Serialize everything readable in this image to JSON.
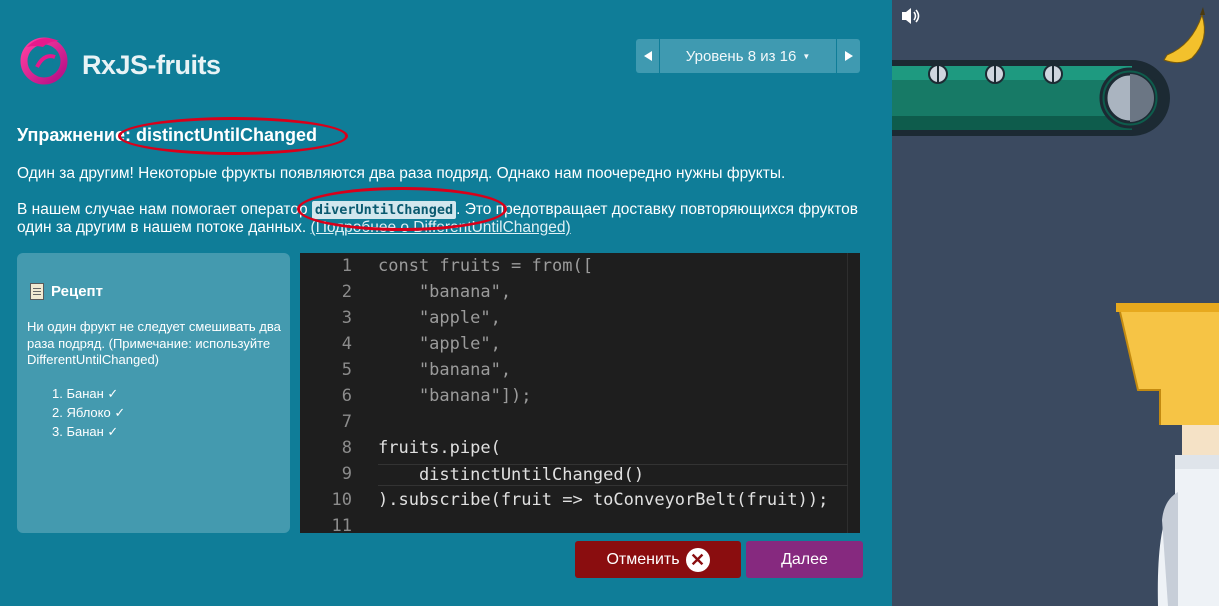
{
  "app": {
    "title": "RxJS-fruits"
  },
  "level_nav": {
    "label": "Уровень 8 из 16",
    "prev_icon": "triangle-left-icon",
    "next_icon": "triangle-right-icon"
  },
  "exercise": {
    "title": "Упражнение: distinctUntilChanged",
    "para1": "Один за другим! Некоторые фрукты появляются два раза подряд. Однако нам поочередно нужны фрукты.",
    "para2_before": "В нашем случае нам помогает оператор ",
    "para2_code": "diverUntilChanged",
    "para2_after": ". Это предотвращает доставку повторяющихся фруктов один за другим в нашем потоке данных. ",
    "para2_link": "(Подробнее о DifferentUntilChanged)"
  },
  "recipe": {
    "title": "Рецепт",
    "text": "Ни один фрукт не следует смешивать два раза подряд. (Примечание: используйте DifferentUntilChanged)",
    "items": [
      "1. Банан ✓",
      "2. Яблоко ✓",
      "3. Банан ✓"
    ]
  },
  "editor": {
    "lines": [
      {
        "n": "1",
        "code": "const fruits = from(["
      },
      {
        "n": "2",
        "code": "    \"banana\","
      },
      {
        "n": "3",
        "code": "    \"apple\","
      },
      {
        "n": "4",
        "code": "    \"apple\","
      },
      {
        "n": "5",
        "code": "    \"banana\","
      },
      {
        "n": "6",
        "code": "    \"banana\"]);"
      },
      {
        "n": "7",
        "code": ""
      },
      {
        "n": "8",
        "code": "fruits.pipe("
      },
      {
        "n": "9",
        "code": "    distinctUntilChanged()"
      },
      {
        "n": "10",
        "code": ").subscribe(fruit => toConveyorBelt(fruit));"
      },
      {
        "n": "11",
        "code": ""
      }
    ]
  },
  "buttons": {
    "cancel": "Отменить",
    "next": "Далее"
  },
  "scene": {
    "sound_icon": "speaker-icon",
    "fruit_icon": "banana-icon"
  },
  "colors": {
    "panel": "#0f7d98",
    "scene_bg": "#3b4a60",
    "cancel": "#8a0d0f",
    "next": "#86297f",
    "highlight": "#d8001a"
  }
}
